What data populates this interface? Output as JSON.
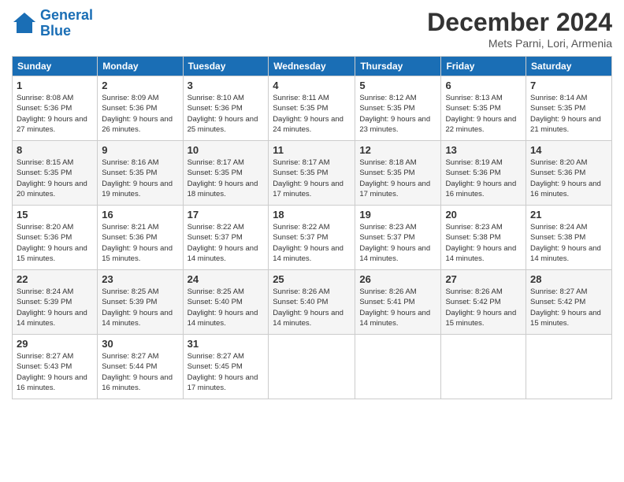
{
  "logo": {
    "line1": "General",
    "line2": "Blue"
  },
  "header": {
    "title": "December 2024",
    "location": "Mets Parni, Lori, Armenia"
  },
  "columns": [
    "Sunday",
    "Monday",
    "Tuesday",
    "Wednesday",
    "Thursday",
    "Friday",
    "Saturday"
  ],
  "weeks": [
    [
      {
        "day": "1",
        "info": "Sunrise: 8:08 AM\nSunset: 5:36 PM\nDaylight: 9 hours and 27 minutes."
      },
      {
        "day": "2",
        "info": "Sunrise: 8:09 AM\nSunset: 5:36 PM\nDaylight: 9 hours and 26 minutes."
      },
      {
        "day": "3",
        "info": "Sunrise: 8:10 AM\nSunset: 5:36 PM\nDaylight: 9 hours and 25 minutes."
      },
      {
        "day": "4",
        "info": "Sunrise: 8:11 AM\nSunset: 5:35 PM\nDaylight: 9 hours and 24 minutes."
      },
      {
        "day": "5",
        "info": "Sunrise: 8:12 AM\nSunset: 5:35 PM\nDaylight: 9 hours and 23 minutes."
      },
      {
        "day": "6",
        "info": "Sunrise: 8:13 AM\nSunset: 5:35 PM\nDaylight: 9 hours and 22 minutes."
      },
      {
        "day": "7",
        "info": "Sunrise: 8:14 AM\nSunset: 5:35 PM\nDaylight: 9 hours and 21 minutes."
      }
    ],
    [
      {
        "day": "8",
        "info": "Sunrise: 8:15 AM\nSunset: 5:35 PM\nDaylight: 9 hours and 20 minutes."
      },
      {
        "day": "9",
        "info": "Sunrise: 8:16 AM\nSunset: 5:35 PM\nDaylight: 9 hours and 19 minutes."
      },
      {
        "day": "10",
        "info": "Sunrise: 8:17 AM\nSunset: 5:35 PM\nDaylight: 9 hours and 18 minutes."
      },
      {
        "day": "11",
        "info": "Sunrise: 8:17 AM\nSunset: 5:35 PM\nDaylight: 9 hours and 17 minutes."
      },
      {
        "day": "12",
        "info": "Sunrise: 8:18 AM\nSunset: 5:35 PM\nDaylight: 9 hours and 17 minutes."
      },
      {
        "day": "13",
        "info": "Sunrise: 8:19 AM\nSunset: 5:36 PM\nDaylight: 9 hours and 16 minutes."
      },
      {
        "day": "14",
        "info": "Sunrise: 8:20 AM\nSunset: 5:36 PM\nDaylight: 9 hours and 16 minutes."
      }
    ],
    [
      {
        "day": "15",
        "info": "Sunrise: 8:20 AM\nSunset: 5:36 PM\nDaylight: 9 hours and 15 minutes."
      },
      {
        "day": "16",
        "info": "Sunrise: 8:21 AM\nSunset: 5:36 PM\nDaylight: 9 hours and 15 minutes."
      },
      {
        "day": "17",
        "info": "Sunrise: 8:22 AM\nSunset: 5:37 PM\nDaylight: 9 hours and 14 minutes."
      },
      {
        "day": "18",
        "info": "Sunrise: 8:22 AM\nSunset: 5:37 PM\nDaylight: 9 hours and 14 minutes."
      },
      {
        "day": "19",
        "info": "Sunrise: 8:23 AM\nSunset: 5:37 PM\nDaylight: 9 hours and 14 minutes."
      },
      {
        "day": "20",
        "info": "Sunrise: 8:23 AM\nSunset: 5:38 PM\nDaylight: 9 hours and 14 minutes."
      },
      {
        "day": "21",
        "info": "Sunrise: 8:24 AM\nSunset: 5:38 PM\nDaylight: 9 hours and 14 minutes."
      }
    ],
    [
      {
        "day": "22",
        "info": "Sunrise: 8:24 AM\nSunset: 5:39 PM\nDaylight: 9 hours and 14 minutes."
      },
      {
        "day": "23",
        "info": "Sunrise: 8:25 AM\nSunset: 5:39 PM\nDaylight: 9 hours and 14 minutes."
      },
      {
        "day": "24",
        "info": "Sunrise: 8:25 AM\nSunset: 5:40 PM\nDaylight: 9 hours and 14 minutes."
      },
      {
        "day": "25",
        "info": "Sunrise: 8:26 AM\nSunset: 5:40 PM\nDaylight: 9 hours and 14 minutes."
      },
      {
        "day": "26",
        "info": "Sunrise: 8:26 AM\nSunset: 5:41 PM\nDaylight: 9 hours and 14 minutes."
      },
      {
        "day": "27",
        "info": "Sunrise: 8:26 AM\nSunset: 5:42 PM\nDaylight: 9 hours and 15 minutes."
      },
      {
        "day": "28",
        "info": "Sunrise: 8:27 AM\nSunset: 5:42 PM\nDaylight: 9 hours and 15 minutes."
      }
    ],
    [
      {
        "day": "29",
        "info": "Sunrise: 8:27 AM\nSunset: 5:43 PM\nDaylight: 9 hours and 16 minutes."
      },
      {
        "day": "30",
        "info": "Sunrise: 8:27 AM\nSunset: 5:44 PM\nDaylight: 9 hours and 16 minutes."
      },
      {
        "day": "31",
        "info": "Sunrise: 8:27 AM\nSunset: 5:45 PM\nDaylight: 9 hours and 17 minutes."
      },
      null,
      null,
      null,
      null
    ]
  ]
}
